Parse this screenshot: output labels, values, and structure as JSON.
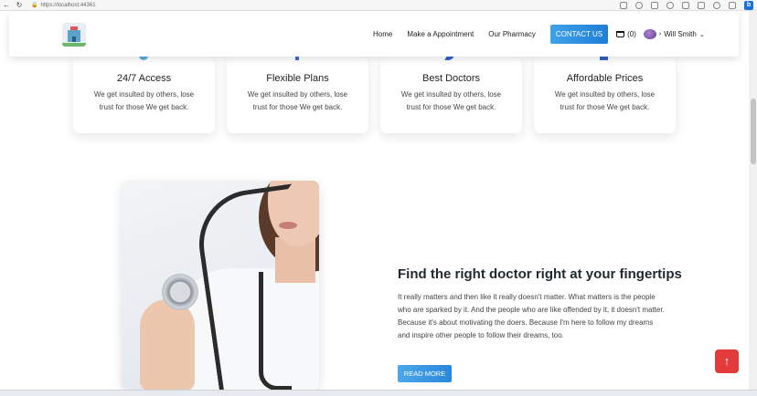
{
  "browser": {
    "url": "https://localhost:44361"
  },
  "navbar": {
    "links": [
      "Home",
      "Make a Appointment",
      "Our Pharmacy"
    ],
    "contact_label": "CONTACT US",
    "cart_count": "(0)",
    "user_name": "Will Smith"
  },
  "features": [
    {
      "title": "24/7 Access",
      "text": "We get insulted by others, lose trust for those We get back.",
      "icon_color": "#5aaede"
    },
    {
      "title": "Flexible Plans",
      "text": "We get insulted by others, lose trust for those We get back.",
      "icon_color": "#3b6fd1"
    },
    {
      "title": "Best Doctors",
      "text": "We get insulted by others, lose trust for those We get back.",
      "icon_color": "#2e62c9"
    },
    {
      "title": "Affordable Prices",
      "text": "We get insulted by others, lose trust for those We get back.",
      "icon_color": "#2e5fc4"
    }
  ],
  "section": {
    "title": "Find the right doctor right at your fingertips",
    "body": "It really matters and then like it really doesn't matter. What matters is the people who are sparked by it. And the people who are like offended by it, it doesn't matter. Because it's about motivating the doers. Because I'm here to follow my dreams and inspire other people to follow their dreams, too.",
    "button_label": "READ MORE"
  },
  "colors": {
    "accent": "#1d7ed8",
    "to_top": "#e33b3b"
  },
  "icons": {
    "to_top": "↑"
  }
}
